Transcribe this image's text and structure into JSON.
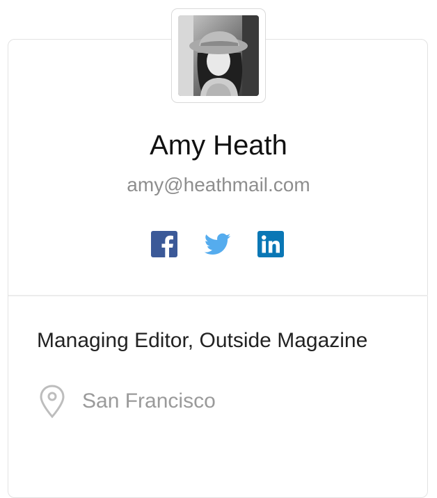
{
  "profile": {
    "name": "Amy Heath",
    "email": "amy@heathmail.com",
    "job_title": "Managing Editor, Outside Magazine",
    "location": "San Francisco"
  },
  "social": [
    {
      "network": "Facebook",
      "icon": "facebook-icon",
      "color": "#3b5998"
    },
    {
      "network": "Twitter",
      "icon": "twitter-icon",
      "color": "#55acee"
    },
    {
      "network": "LinkedIn",
      "icon": "linkedin-icon",
      "color": "#0a77b5"
    }
  ],
  "colors": {
    "name_text": "#111111",
    "email_text": "#8e8e8e",
    "border": "#e2e2e2"
  },
  "icons": {
    "location": "location-pin-icon",
    "avatar": "avatar"
  }
}
